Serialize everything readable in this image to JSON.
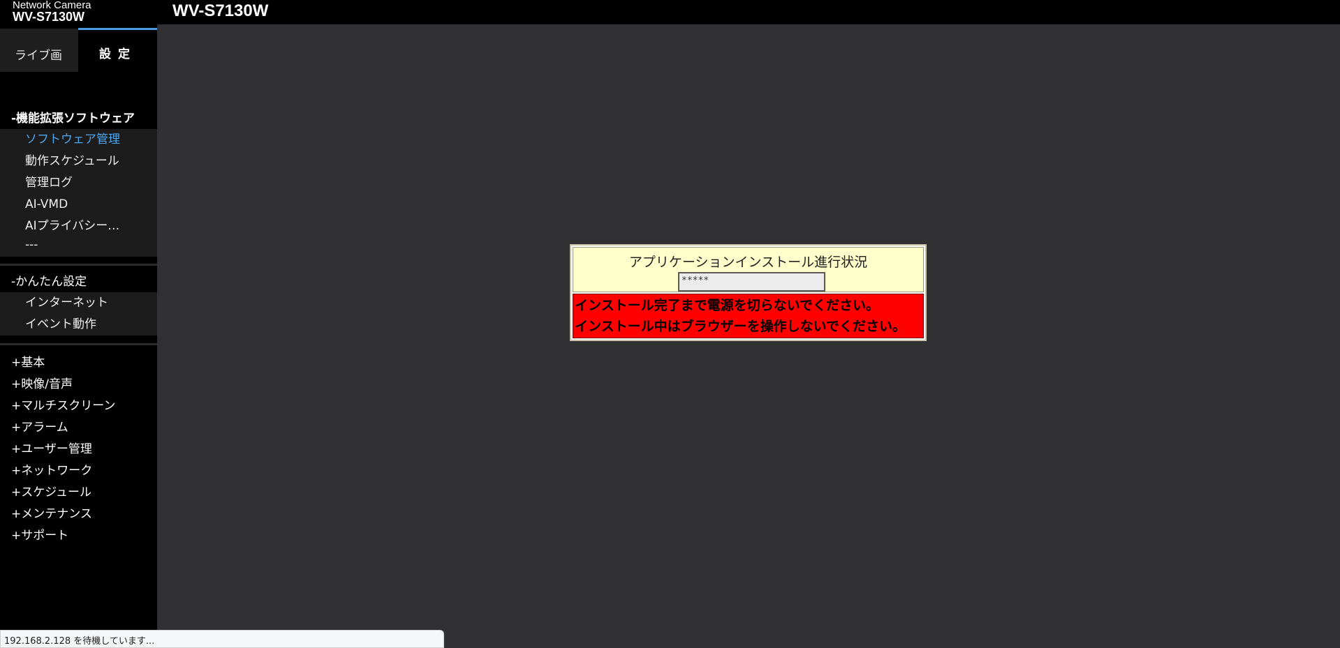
{
  "header": {
    "brand_sub": "Network Camera",
    "brand_model": "WV-S7130W",
    "page_model": "WV-S7130W"
  },
  "tabs": {
    "live": "ライブ画",
    "settings": "設定"
  },
  "sidebar": {
    "groups": [
      {
        "label": "-機能拡張ソフトウェア",
        "items": [
          "ソフトウェア管理",
          "動作スケジュール",
          "管理ログ",
          "AI-VMD",
          "AIプライバシー…",
          "---"
        ]
      },
      {
        "label": "-かんたん設定",
        "items": [
          "インターネット",
          "イベント動作"
        ]
      }
    ],
    "menu": [
      "+基本",
      "+映像/音声",
      "+マルチスクリーン",
      "+アラーム",
      "+ユーザー管理",
      "+ネットワーク",
      "+スケジュール",
      "+メンテナンス",
      "+サポート"
    ]
  },
  "dialog": {
    "title": "アプリケーションインストール進行状況",
    "progress": "*****",
    "warning_line1": "インストール完了まで電源を切らないでください。",
    "warning_line2": "インストール中はブラウザーを操作しないでください。"
  },
  "statusbar": {
    "text": "192.168.2.128 を待機しています..."
  },
  "colors": {
    "accent": "#4ea6ef",
    "content_bg": "#313033",
    "dialog_bg": "#ffffcc",
    "warning_bg": "#ff0000"
  }
}
